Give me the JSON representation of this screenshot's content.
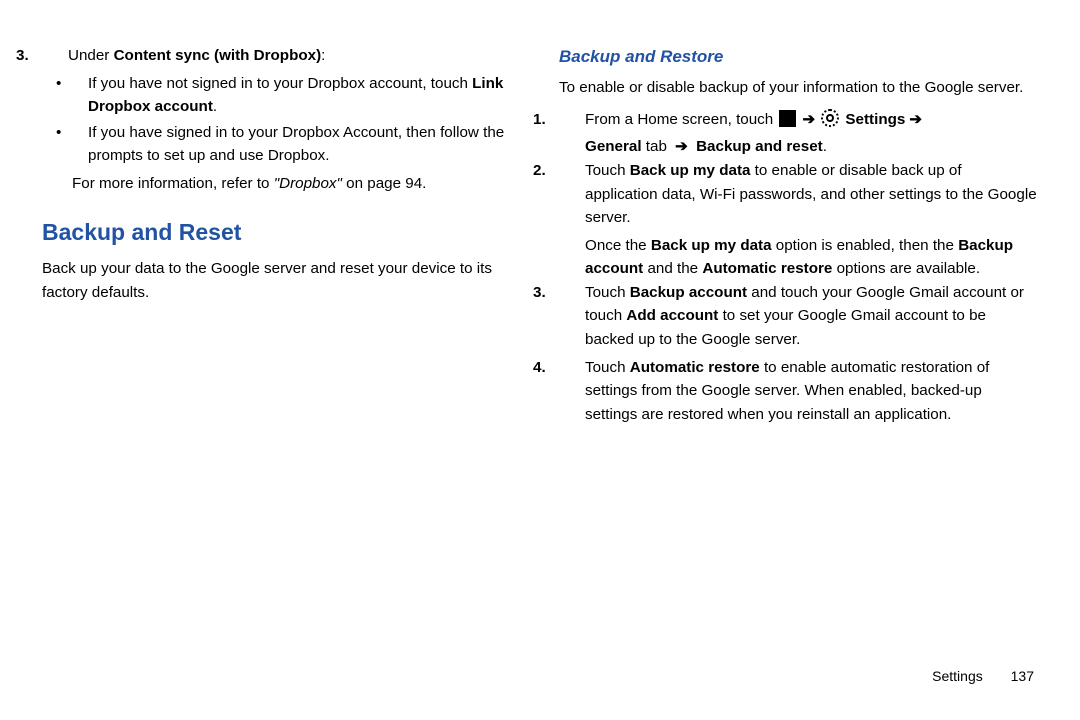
{
  "left": {
    "step3": {
      "num": "3.",
      "line_pre": "Under ",
      "line_bold": "Content sync (with Dropbox)",
      "line_post": ":",
      "sub1": {
        "dot": "•",
        "pre": "If you have not signed in to your Dropbox account, touch ",
        "bold": "Link Dropbox account",
        "post": "."
      },
      "sub2": {
        "dot": "•",
        "text": "If you have signed in to your Dropbox Account, then follow the prompts to set up and use Dropbox."
      },
      "ref_pre": "For more information, refer to ",
      "ref_italic": "\"Dropbox\"",
      "ref_post": " on page 94."
    },
    "h1": "Backup and Reset",
    "h1_intro": "Back up your data to the Google server and reset your device to its factory defaults."
  },
  "right": {
    "h2": "Backup and Restore",
    "h2_intro": "To enable or disable backup of your information to the Google server.",
    "step1": {
      "num": "1.",
      "pre": "From a Home screen, touch ",
      "settings": "Settings",
      "line2_pre_bold": "General",
      "line2_mid": " tab ",
      "line2_bold2": "Backup and reset",
      "line2_post": "."
    },
    "step2": {
      "num": "2.",
      "pre": "Touch ",
      "b1": "Back up my data",
      "mid": " to enable or disable back up of application data, Wi-Fi passwords, and other settings to the Google server.",
      "p2_pre": "Once the ",
      "p2_b1": "Back up my data",
      "p2_mid": " option is enabled, then the ",
      "p2_b2": "Backup account",
      "p2_mid2": " and the ",
      "p2_b3": "Automatic restore",
      "p2_post": " options are available."
    },
    "step3": {
      "num": "3.",
      "pre": "Touch ",
      "b1": "Backup account",
      "mid": " and touch your Google Gmail account or touch ",
      "b2": "Add account",
      "post": " to set your Google Gmail account to be backed up to the Google server."
    },
    "step4": {
      "num": "4.",
      "pre": "Touch ",
      "b1": "Automatic restore",
      "post": " to enable automatic restoration of settings from the Google server. When enabled, backed-up settings are restored when you reinstall an application."
    }
  },
  "footer": {
    "section": "Settings",
    "page": "137"
  },
  "glyphs": {
    "arrow": "➔"
  }
}
